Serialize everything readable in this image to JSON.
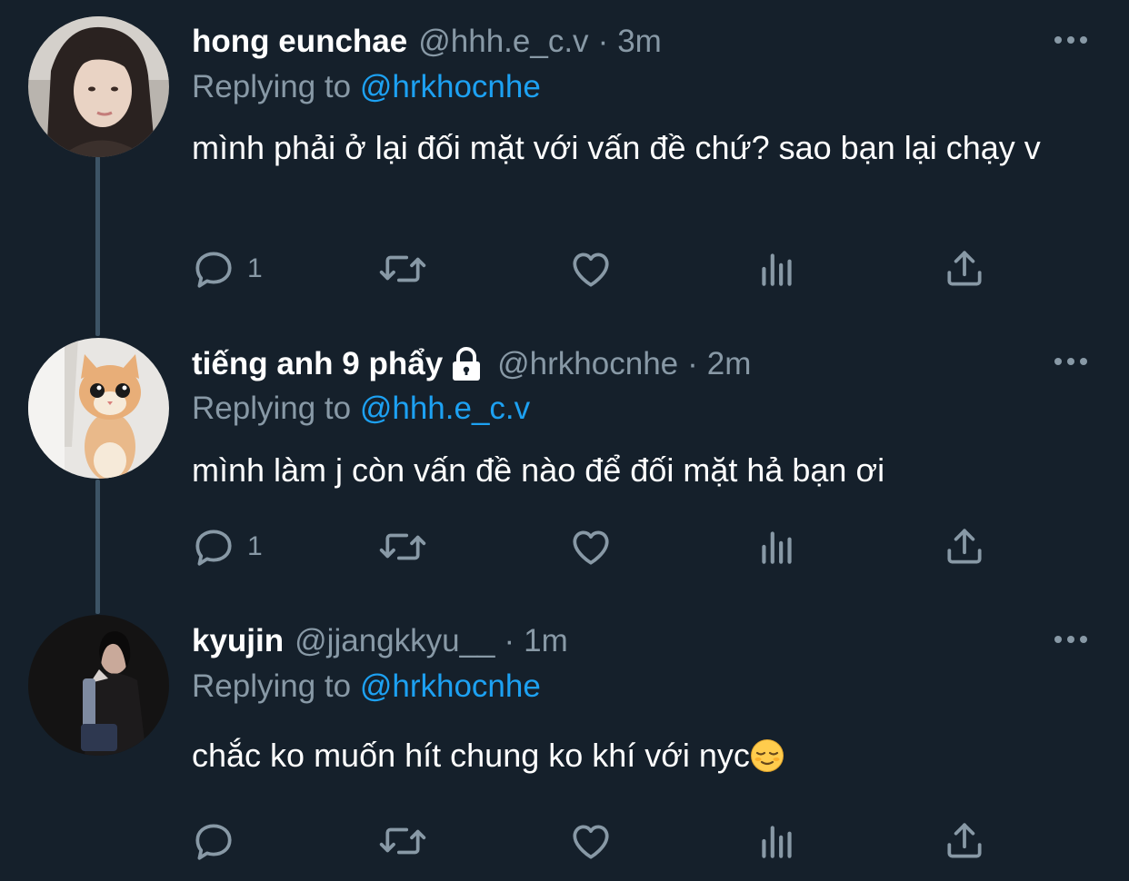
{
  "colors": {
    "background": "#15202b",
    "secondary_text": "#8899a6",
    "mention": "#1da1f2",
    "thread_line": "#3d5466"
  },
  "tweets": [
    {
      "name": "hong eunchae",
      "handle": "@hhh.e_c.v",
      "dot": "·",
      "time": "3m",
      "replying_label": "Replying to",
      "replying_to": "@hrkhocnhe",
      "text": "mình phải ở lại đối mặt với vấn đề chứ? sao bạn lại chạy v",
      "reply_count": "1",
      "locked": false,
      "avatar": "person-photo-avatar"
    },
    {
      "name": "tiếng anh 9 phẩy",
      "handle": "@hrkhocnhe",
      "dot": "·",
      "time": "2m",
      "replying_label": "Replying to",
      "replying_to": "@hhh.e_c.v",
      "text": "mình làm j còn vấn đề nào để đối mặt hả bạn ơi",
      "reply_count": "1",
      "locked": true,
      "avatar": "kitten-avatar"
    },
    {
      "name": "kyujin",
      "handle": "@jjangkkyu__",
      "dot": "·",
      "time": "1m",
      "replying_label": "Replying to",
      "replying_to": "@hrkhocnhe",
      "text": "chắc ko muốn hít chung ko khí với nyc",
      "reply_count": "",
      "locked": false,
      "avatar": "dark-person-avatar",
      "trailing_emoji": "relieved-face-emoji"
    }
  ],
  "icons": {
    "reply": "reply-icon",
    "retweet": "retweet-icon",
    "like": "heart-icon",
    "analytics": "analytics-icon",
    "share": "share-icon",
    "more": "more-options-icon",
    "lock": "lock-icon"
  }
}
